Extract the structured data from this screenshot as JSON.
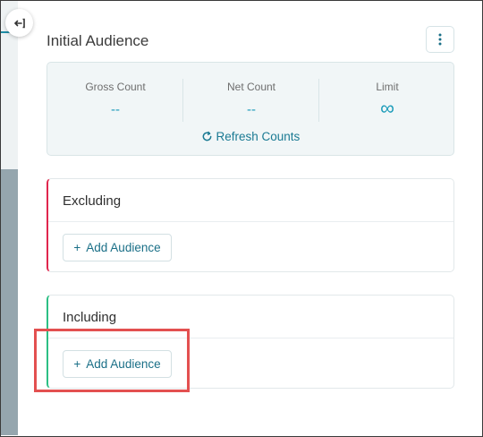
{
  "panel": {
    "title": "Initial Audience",
    "menu_icon": "kebab-vertical-icon",
    "collapse_icon": "collapse-left-icon"
  },
  "counts": {
    "gross_label": "Gross Count",
    "gross_value": "--",
    "net_label": "Net Count",
    "net_value": "--",
    "limit_label": "Limit",
    "limit_value": "∞",
    "refresh_label": "Refresh Counts",
    "refresh_icon": "refresh-icon"
  },
  "excluding": {
    "title": "Excluding",
    "add_label": "Add Audience",
    "plus": "+"
  },
  "including": {
    "title": "Including",
    "add_label": "Add Audience",
    "plus": "+"
  },
  "colors": {
    "accent": "#1b9bb9",
    "excluding_bar": "#e0264d",
    "including_bar": "#2cbf84",
    "highlight": "#e35050"
  }
}
